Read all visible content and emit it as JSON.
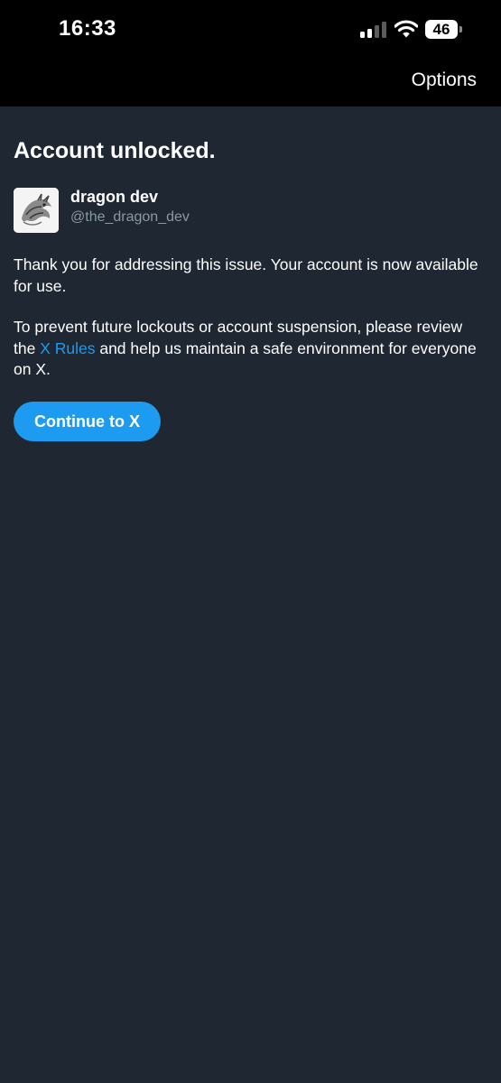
{
  "status_bar": {
    "time": "16:33",
    "battery_level": "46",
    "cellular_bars_active": 2,
    "cellular_bars_total": 4,
    "icons": [
      "cellular-signal-icon",
      "wifi-icon",
      "battery-icon"
    ]
  },
  "header": {
    "options_label": "Options"
  },
  "main": {
    "title": "Account unlocked.",
    "user": {
      "display_name": "dragon dev",
      "handle": "@the_dragon_dev"
    },
    "paragraph1": "Thank you for addressing this issue. Your account is now available for use.",
    "paragraph2_before": "To prevent future lockouts or account suspension, please review the ",
    "paragraph2_link": "X Rules",
    "paragraph2_after": " and help us maintain a safe environment for everyone on X.",
    "continue_label": "Continue to X"
  },
  "colors": {
    "background": "#1e2732",
    "top_bar": "#000000",
    "accent": "#1d9bf0",
    "secondary_text": "#8b98a5"
  }
}
